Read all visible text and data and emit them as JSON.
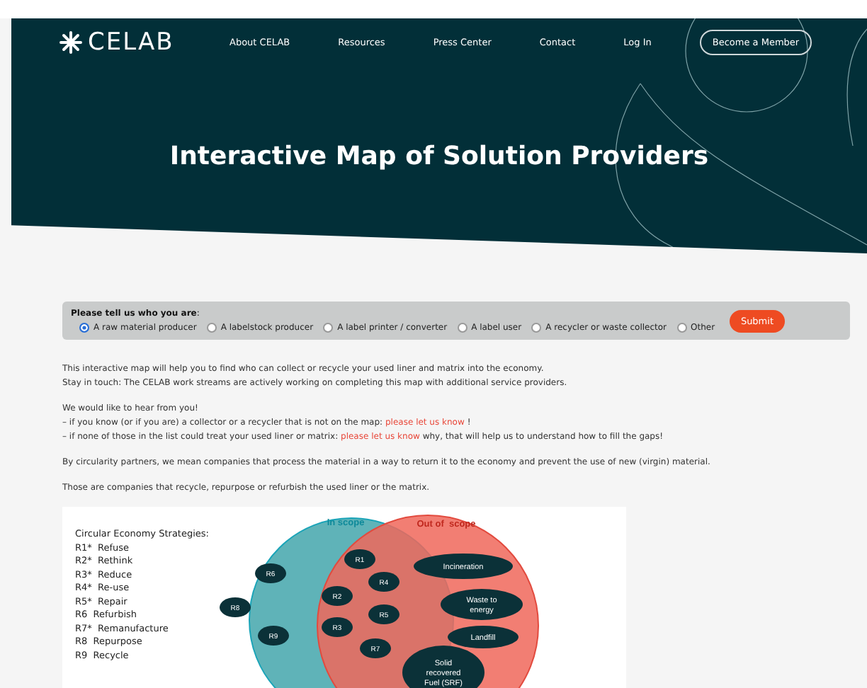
{
  "header": {
    "logo": "CELAB",
    "nav": [
      "About CELAB",
      "Resources",
      "Press Center",
      "Contact",
      "Log In"
    ],
    "cta": "Become a Member",
    "title": "Interactive Map of Solution Providers"
  },
  "form": {
    "prompt": "Please tell us who you are",
    "prompt_suffix": ":",
    "options": [
      {
        "label": "A raw material producer",
        "selected": true
      },
      {
        "label": "A labelstock producer",
        "selected": false
      },
      {
        "label": "A label printer / converter",
        "selected": false
      },
      {
        "label": "A label user",
        "selected": false
      },
      {
        "label": "A recycler or waste collector",
        "selected": false
      },
      {
        "label": "Other",
        "selected": false
      }
    ],
    "submit": "Submit"
  },
  "paragraphs": [
    {
      "lines": [
        {
          "text": "This interactive map will help you to find who can collect or recycle your used liner and matrix into the economy."
        },
        {
          "text": "Stay in touch: The CELAB work streams are actively working on completing this map with additional service providers."
        }
      ]
    },
    {
      "lines": [
        {
          "text": "We would like to hear from you!"
        },
        {
          "text": "– if you know (or if you are) a collector or a recycler that is not on the map:",
          "link": "please let us know",
          "after": "!"
        },
        {
          "text": "– if none of those in the list could treat your used liner or matrix:",
          "link": "please let us know",
          "after": "why, that will help us to understand how to fill the gaps!"
        }
      ]
    },
    {
      "lines": [
        {
          "text": "By circularity partners, we mean companies that process the material in a way to return it to the economy and prevent the use of new (virgin) material."
        }
      ]
    },
    {
      "lines": [
        {
          "text": "Those are companies that recycle, repurpose or refurbish the used liner or the matrix."
        }
      ]
    }
  ],
  "diagram": {
    "legend_title": "Circular Economy Strategies:",
    "legend": [
      "R1*  Refuse",
      "R2*  Rethink",
      "R3*  Reduce",
      "R4*  Re-use",
      "R5*  Repair",
      "R6  Refurbish",
      "R7*  Remanufacture",
      "R8  Repurpose",
      "R9  Recycle"
    ],
    "in_scope": "In scope",
    "out_scope": "Out of  scope",
    "nodes": [
      {
        "label": [
          "R6"
        ],
        "kind": "small"
      },
      {
        "label": [
          "R8"
        ],
        "kind": "small"
      },
      {
        "label": [
          "R9"
        ],
        "kind": "small"
      },
      {
        "label": [
          "R1"
        ],
        "kind": "small"
      },
      {
        "label": [
          "R4"
        ],
        "kind": "small"
      },
      {
        "label": [
          "R2"
        ],
        "kind": "small"
      },
      {
        "label": [
          "R5"
        ],
        "kind": "small"
      },
      {
        "label": [
          "R3"
        ],
        "kind": "small"
      },
      {
        "label": [
          "R7"
        ],
        "kind": "small"
      },
      {
        "label": [
          "Incineration"
        ],
        "kind": "large"
      },
      {
        "label": [
          "Waste to",
          "energy"
        ],
        "kind": "large"
      },
      {
        "label": [
          "Landfill"
        ],
        "kind": "large"
      },
      {
        "label": [
          "Solid",
          "recovered",
          "Fuel (SRF)"
        ],
        "kind": "large"
      }
    ]
  }
}
